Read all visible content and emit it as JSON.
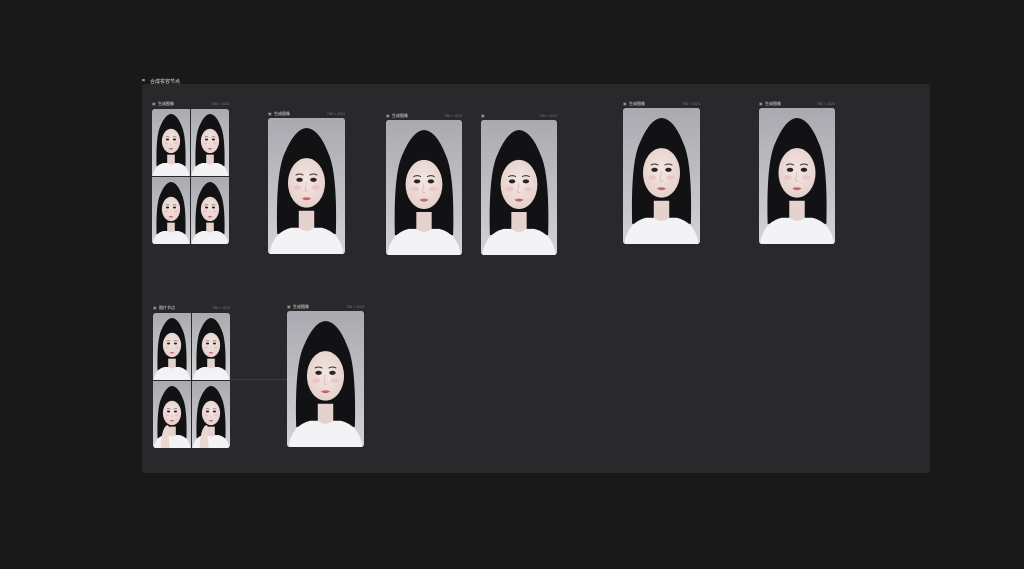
{
  "canvas": {
    "background": "#191919",
    "panel_background": "#29292b"
  },
  "group": {
    "icon": "frame-icon",
    "label": "合成妆容节点"
  },
  "nodes": [
    {
      "id": "n1",
      "icon": "image-node-icon",
      "title": "生成图像",
      "meta": "768 × 1024",
      "type": "grid"
    },
    {
      "id": "n2",
      "icon": "image-node-icon",
      "title": "生成图像",
      "meta": "768 × 1024",
      "type": "single"
    },
    {
      "id": "n3",
      "icon": "image-node-icon",
      "title": "生成图像",
      "meta": "768 × 1024",
      "type": "single"
    },
    {
      "id": "n4",
      "icon": "image-node-icon",
      "title": "",
      "meta": "768 × 1024",
      "type": "single"
    },
    {
      "id": "n5",
      "icon": "image-node-icon",
      "title": "生成图像",
      "meta": "768 × 1024",
      "type": "single"
    },
    {
      "id": "n6",
      "icon": "image-node-icon",
      "title": "生成图像",
      "meta": "768 × 1024",
      "type": "single"
    },
    {
      "id": "n7",
      "icon": "image-node-icon",
      "title": "图片节点",
      "meta": "768 × 1024",
      "type": "grid"
    },
    {
      "id": "n8",
      "icon": "image-node-icon",
      "title": "生成图像",
      "meta": "768 × 1024",
      "type": "single"
    }
  ],
  "image_subject": "portrait-photo"
}
